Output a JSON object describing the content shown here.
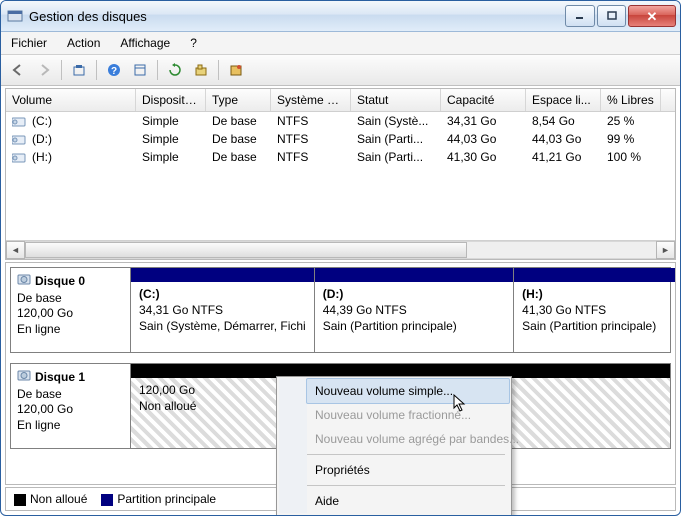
{
  "window": {
    "title": "Gestion des disques"
  },
  "menu": {
    "file": "Fichier",
    "action": "Action",
    "view": "Affichage",
    "help": "?"
  },
  "list": {
    "headers": {
      "volume": "Volume",
      "disposition": "Disposition",
      "type": "Type",
      "fs": "Système de ...",
      "status": "Statut",
      "capacity": "Capacité",
      "free": "Espace li...",
      "pct": "% Libres"
    },
    "rows": [
      {
        "volume": "(C:)",
        "disposition": "Simple",
        "type": "De base",
        "fs": "NTFS",
        "status": "Sain (Systè...",
        "capacity": "34,31 Go",
        "free": "8,54 Go",
        "pct": "25 %"
      },
      {
        "volume": "(D:)",
        "disposition": "Simple",
        "type": "De base",
        "fs": "NTFS",
        "status": "Sain (Parti...",
        "capacity": "44,03 Go",
        "free": "44,03 Go",
        "pct": "99 %"
      },
      {
        "volume": "(H:)",
        "disposition": "Simple",
        "type": "De base",
        "fs": "NTFS",
        "status": "Sain (Parti...",
        "capacity": "41,30 Go",
        "free": "41,21 Go",
        "pct": "100 %"
      }
    ]
  },
  "disks": [
    {
      "name": "Disque 0",
      "type": "De base",
      "size": "120,00 Go",
      "status": "En ligne",
      "parts": [
        {
          "kind": "primary",
          "title": "(C:)",
          "line2": "34,31 Go NTFS",
          "line3": "Sain (Système, Démarrer, Fichi",
          "width": 30
        },
        {
          "kind": "primary",
          "title": "(D:)",
          "line2": "44,39 Go NTFS",
          "line3": "Sain (Partition principale)",
          "width": 37
        },
        {
          "kind": "primary",
          "title": "(H:)",
          "line2": "41,30 Go NTFS",
          "line3": "Sain (Partition principale)",
          "width": 33
        }
      ]
    },
    {
      "name": "Disque 1",
      "type": "De base",
      "size": "120,00 Go",
      "status": "En ligne",
      "parts": [
        {
          "kind": "unalloc",
          "title": "",
          "line2": "120,00 Go",
          "line3": "Non alloué",
          "width": 100
        }
      ]
    }
  ],
  "legend": {
    "unalloc": "Non alloué",
    "primary": "Partition principale"
  },
  "context": {
    "new_simple": "Nouveau volume simple...",
    "new_spanned": "Nouveau volume fractionné...",
    "new_striped": "Nouveau volume agrégé par bandes...",
    "properties": "Propriétés",
    "help": "Aide"
  }
}
